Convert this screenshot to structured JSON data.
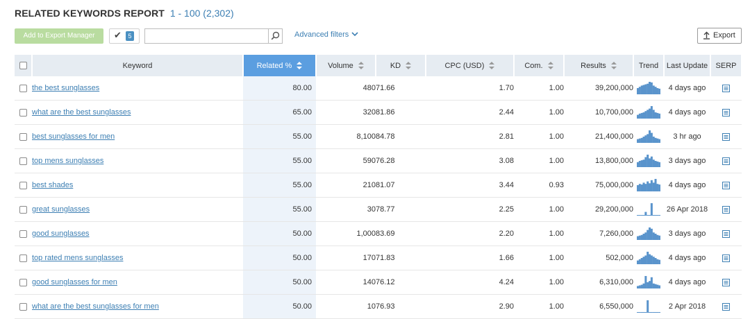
{
  "report": {
    "title": "RELATED KEYWORDS REPORT",
    "range": "1 - 100 (2,302)"
  },
  "toolbar": {
    "add_to_export_label": "Add to Export Manager",
    "selected_count": "5",
    "search_value": "",
    "search_placeholder": "",
    "advanced_filters_label": "Advanced filters",
    "export_label": "Export"
  },
  "table": {
    "columns": [
      "Keyword",
      "Related %",
      "Volume",
      "KD",
      "CPC (USD)",
      "Com.",
      "Results",
      "Trend",
      "Last Update",
      "SERP"
    ],
    "sorted_column": "Related %",
    "rows": [
      {
        "keyword": "the best sunglasses",
        "related": "80.00",
        "volume": "480",
        "kd": "71.66",
        "cpc": "1.70",
        "com": "1.00",
        "results": "39,200,000",
        "trend": [
          0.5,
          0.6,
          0.7,
          0.75,
          0.8,
          0.85,
          1.0,
          0.95,
          0.7,
          0.6,
          0.5,
          0.45
        ],
        "last_update": "4 days ago"
      },
      {
        "keyword": "what are the best sunglasses",
        "related": "65.00",
        "volume": "320",
        "kd": "81.86",
        "cpc": "2.44",
        "com": "1.00",
        "results": "10,700,000",
        "trend": [
          0.3,
          0.4,
          0.45,
          0.5,
          0.6,
          0.7,
          0.8,
          1.0,
          0.7,
          0.5,
          0.45,
          0.4
        ],
        "last_update": "4 days ago"
      },
      {
        "keyword": "best sunglasses for men",
        "related": "55.00",
        "volume": "8,100",
        "kd": "84.78",
        "cpc": "2.81",
        "com": "1.00",
        "results": "21,400,000",
        "trend": [
          0.3,
          0.35,
          0.4,
          0.5,
          0.6,
          0.7,
          1.0,
          0.8,
          0.5,
          0.4,
          0.35,
          0.3
        ],
        "last_update": "3 hr ago"
      },
      {
        "keyword": "top mens sunglasses",
        "related": "55.00",
        "volume": "590",
        "kd": "76.28",
        "cpc": "3.08",
        "com": "1.00",
        "results": "13,800,000",
        "trend": [
          0.4,
          0.5,
          0.55,
          0.6,
          0.8,
          1.0,
          0.7,
          0.85,
          0.6,
          0.5,
          0.45,
          0.4
        ],
        "last_update": "3 days ago"
      },
      {
        "keyword": "best shades",
        "related": "55.00",
        "volume": "210",
        "kd": "81.07",
        "cpc": "3.44",
        "com": "0.93",
        "results": "75,000,000",
        "trend": [
          0.5,
          0.6,
          0.55,
          0.7,
          0.6,
          0.8,
          0.65,
          0.9,
          0.7,
          1.0,
          0.6,
          0.55
        ],
        "last_update": "4 days ago"
      },
      {
        "keyword": "great sunglasses",
        "related": "55.00",
        "volume": "30",
        "kd": "78.77",
        "cpc": "2.25",
        "com": "1.00",
        "results": "29,200,000",
        "trend": [
          0.05,
          0.05,
          0.05,
          0.05,
          0.3,
          0.05,
          0.05,
          1.0,
          0.05,
          0.05,
          0.05,
          0.05
        ],
        "last_update": "26 Apr 2018"
      },
      {
        "keyword": "good sunglasses",
        "related": "50.00",
        "volume": "1,000",
        "kd": "83.69",
        "cpc": "2.20",
        "com": "1.00",
        "results": "7,260,000",
        "trend": [
          0.3,
          0.35,
          0.4,
          0.5,
          0.6,
          0.8,
          1.0,
          0.9,
          0.6,
          0.5,
          0.4,
          0.35
        ],
        "last_update": "3 days ago"
      },
      {
        "keyword": "top rated mens sunglasses",
        "related": "50.00",
        "volume": "170",
        "kd": "71.83",
        "cpc": "1.66",
        "com": "1.00",
        "results": "502,000",
        "trend": [
          0.3,
          0.4,
          0.5,
          0.6,
          0.7,
          1.0,
          0.8,
          0.7,
          0.6,
          0.5,
          0.4,
          0.35
        ],
        "last_update": "4 days ago"
      },
      {
        "keyword": "good sunglasses for men",
        "related": "50.00",
        "volume": "140",
        "kd": "76.12",
        "cpc": "4.24",
        "com": "1.00",
        "results": "6,310,000",
        "trend": [
          0.2,
          0.25,
          0.3,
          0.4,
          1.0,
          0.5,
          0.6,
          0.9,
          0.4,
          0.35,
          0.3,
          0.25
        ],
        "last_update": "4 days ago"
      },
      {
        "keyword": "what are the best sunglasses for men",
        "related": "50.00",
        "volume": "10",
        "kd": "76.93",
        "cpc": "2.90",
        "com": "1.00",
        "results": "6,550,000",
        "trend": [
          0.05,
          0.05,
          0.05,
          0.05,
          0.05,
          1.0,
          0.05,
          0.05,
          0.05,
          0.05,
          0.05,
          0.05
        ],
        "last_update": "2 Apr 2018"
      }
    ]
  },
  "colors": {
    "accent": "#5b9ee0",
    "link": "#3d7fb3",
    "trend_bar": "#5a94cc",
    "add_button": "#b9dca0"
  }
}
